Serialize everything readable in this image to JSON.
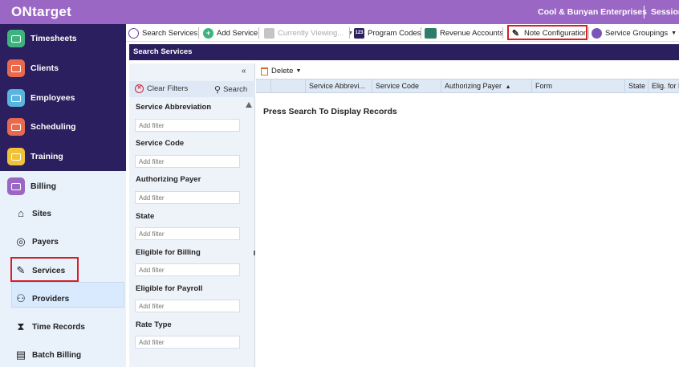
{
  "topbar": {
    "logo": "ONtarget",
    "company": "Cool & Bunyan Enterprises",
    "session": "Session"
  },
  "sidebar": {
    "cut_item": "Timesheets",
    "menu": [
      {
        "label": "Clients",
        "icon": "clients-icon",
        "color": "#e86a4e"
      },
      {
        "label": "Employees",
        "icon": "employees-icon",
        "color": "#5ab4e0"
      },
      {
        "label": "Scheduling",
        "icon": "scheduling-icon",
        "color": "#e86a4e"
      },
      {
        "label": "Training",
        "icon": "training-icon",
        "color": "#f0c23a"
      },
      {
        "label": "Billing",
        "icon": "billing-icon",
        "color": "#9b67c4"
      }
    ],
    "billing_sub": [
      {
        "label": "Sites",
        "icon": "sites-icon"
      },
      {
        "label": "Payers",
        "icon": "payers-icon"
      },
      {
        "label": "Services",
        "icon": "services-icon"
      },
      {
        "label": "Providers",
        "icon": "providers-icon"
      },
      {
        "label": "Time Records",
        "icon": "time-records-icon"
      },
      {
        "label": "Batch Billing",
        "icon": "batch-billing-icon"
      }
    ]
  },
  "toolbar": {
    "search_services": "Search Services",
    "add_service": "Add Service",
    "currently_viewing": "Currently Viewing...",
    "program_codes": "Program Codes",
    "revenue_accounts": "Revenue Accounts",
    "note_configuration": "Note Configuration",
    "service_groupings": "Service Groupings"
  },
  "panel": {
    "title": "Search Services"
  },
  "filters": {
    "clear_label": "Clear Filters",
    "search_label": "Search",
    "placeholder": "Add filter",
    "fields": [
      "Service Abbreviation",
      "Service Code",
      "Authorizing Payer",
      "State",
      "Eligible for Billing",
      "Eligible for Payroll",
      "Rate Type"
    ]
  },
  "grid": {
    "delete_label": "Delete",
    "columns": [
      "Service Abbrevi...",
      "Service Code",
      "Authorizing Payer",
      "Form",
      "State",
      "Elig. for Bi"
    ],
    "empty_message": "Press Search To Display Records"
  },
  "colors": {
    "brand": "#9b67c4",
    "nav_dark": "#2c1f5f",
    "highlight_border": "#d91f26"
  }
}
